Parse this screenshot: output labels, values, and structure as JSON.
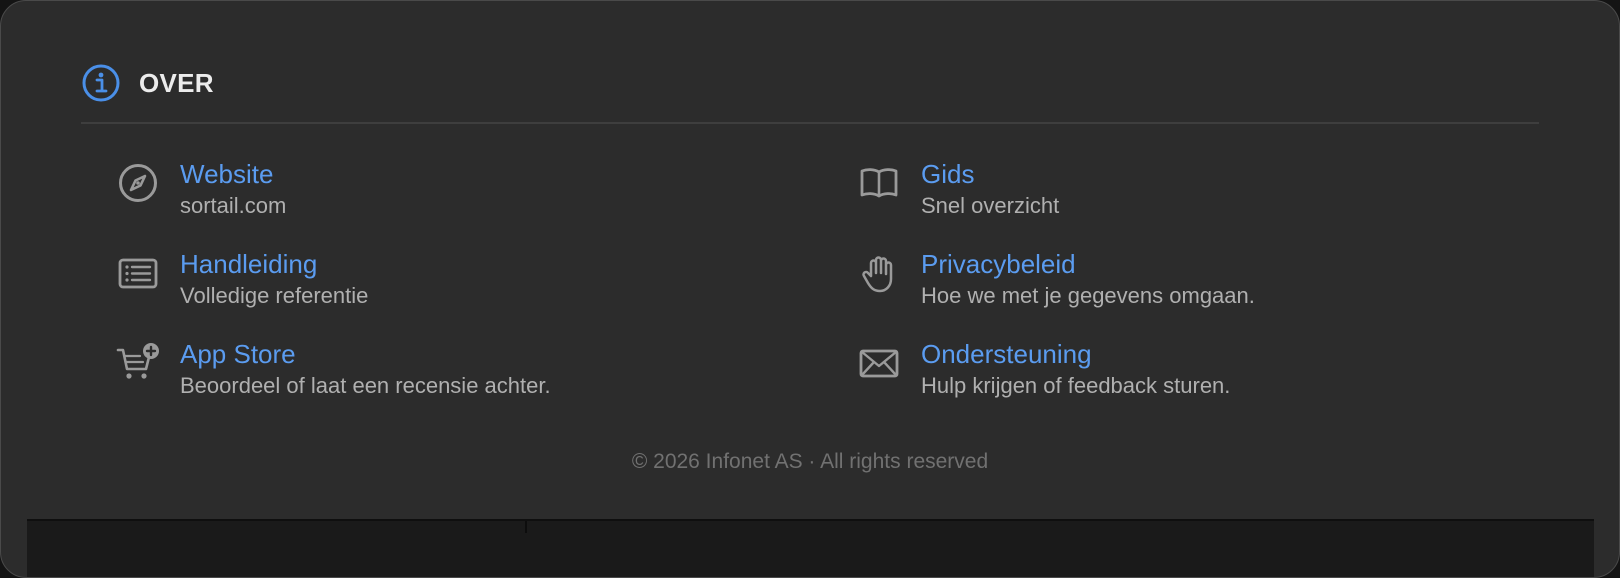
{
  "header": {
    "icon": "info-circle-icon",
    "title": "OVER",
    "accent_color": "#4a8fe8"
  },
  "links": [
    {
      "id": "website",
      "icon": "compass-icon",
      "label": "Website",
      "subtitle": "sortail.com"
    },
    {
      "id": "guide",
      "icon": "book-icon",
      "label": "Gids",
      "subtitle": "Snel overzicht"
    },
    {
      "id": "manual",
      "icon": "list-document-icon",
      "label": "Handleiding",
      "subtitle": "Volledige referentie"
    },
    {
      "id": "privacy",
      "icon": "hand-icon",
      "label": "Privacybeleid",
      "subtitle": "Hoe we met je gegevens omgaan."
    },
    {
      "id": "appstore",
      "icon": "cart-plus-icon",
      "label": "App Store",
      "subtitle": "Beoordeel of laat een recensie achter."
    },
    {
      "id": "support",
      "icon": "envelope-icon",
      "label": "Ondersteuning",
      "subtitle": "Hulp krijgen of feedback sturen."
    }
  ],
  "footer": {
    "copyright": "© 2026 Infonet AS · All rights reserved"
  },
  "colors": {
    "link": "#5b9cf0",
    "background": "#2c2c2c",
    "subtitle": "#b0b0b0"
  }
}
